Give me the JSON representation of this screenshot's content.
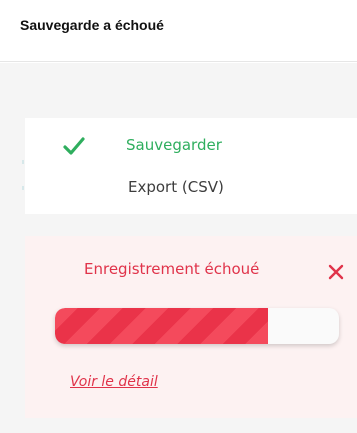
{
  "window": {
    "title": "Sauvegarde a échoué"
  },
  "menu": {
    "items": [
      {
        "label": "Sauvegarder",
        "icon": "check-icon",
        "color": "#2fae5e"
      },
      {
        "label": "Export (CSV)",
        "color": "#3d3d3d"
      }
    ]
  },
  "error": {
    "message": "Enregistrement échoué",
    "close_icon": "close-icon",
    "progress_fraction": 0.75,
    "detail_link": "Voir le détail",
    "color": "#e0334a"
  }
}
